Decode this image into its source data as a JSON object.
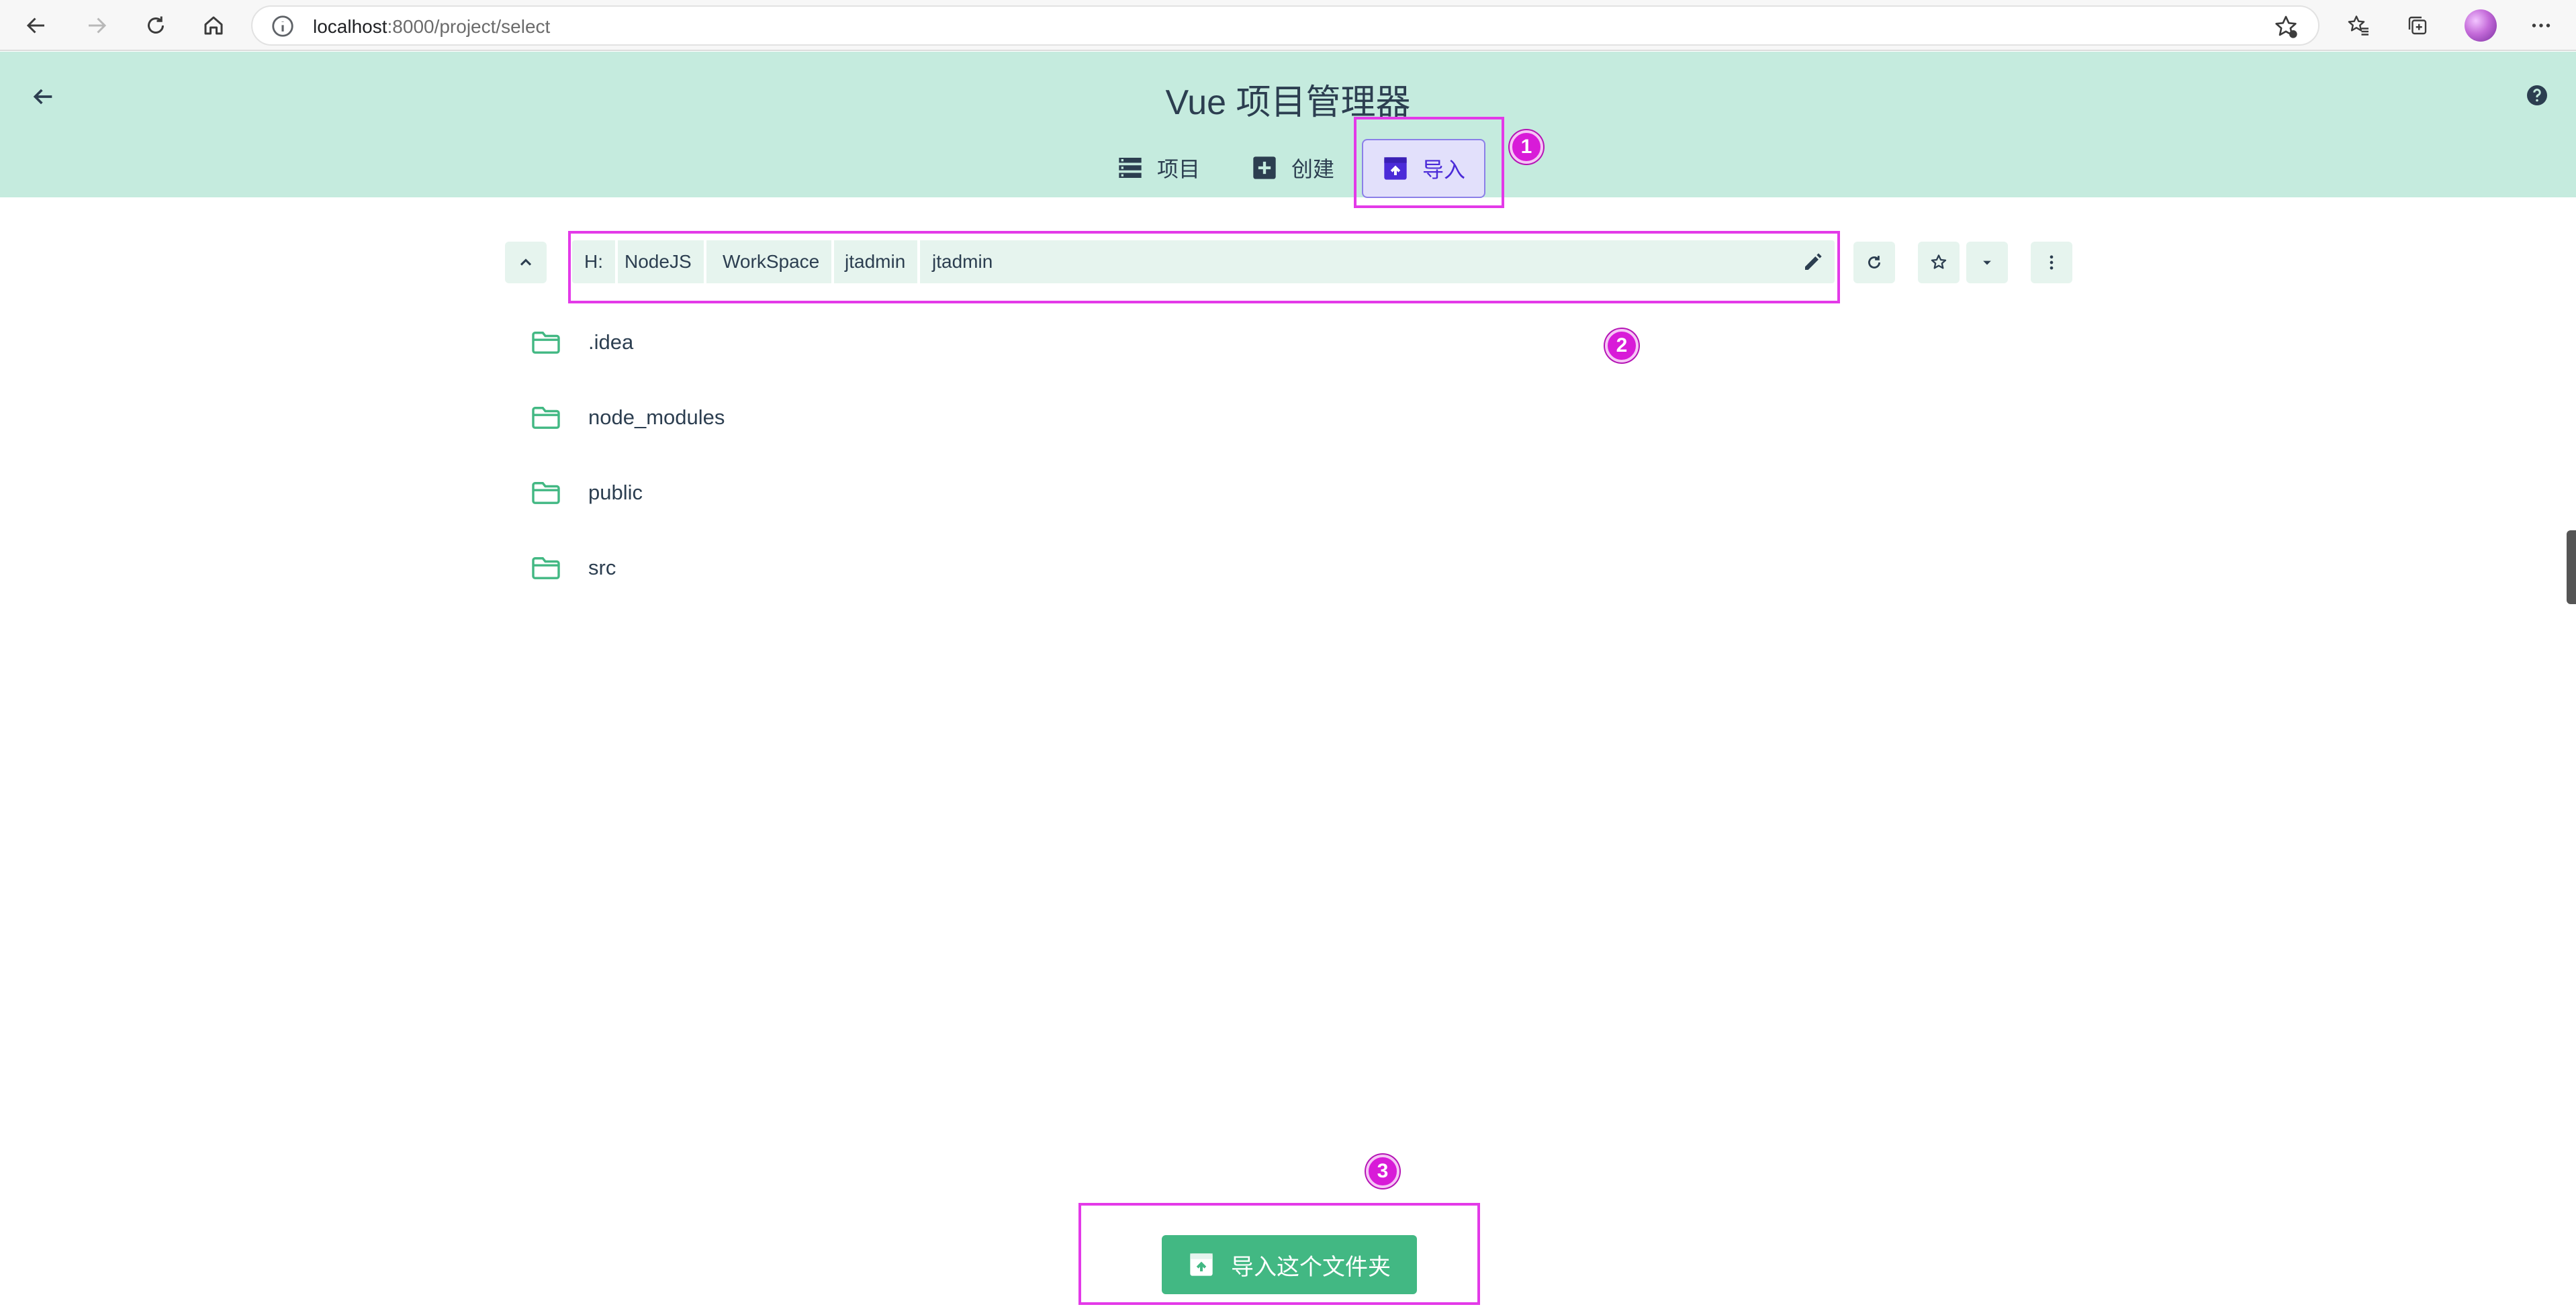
{
  "browser": {
    "url_host": "localhost",
    "url_path": ":8000/project/select"
  },
  "header": {
    "title": "Vue 项目管理器",
    "tabs": [
      {
        "label": "项目",
        "icon": "list-icon",
        "active": false
      },
      {
        "label": "创建",
        "icon": "add-box-icon",
        "active": false
      },
      {
        "label": "导入",
        "icon": "unarchive-icon",
        "active": true
      }
    ]
  },
  "explorer": {
    "path_segments": [
      "H:",
      "NodeJS",
      "WorkSpace",
      "jtadmin",
      "jtadmin"
    ],
    "folders": [
      ".idea",
      "node_modules",
      "public",
      "src"
    ]
  },
  "actions": {
    "import_folder_label": "导入这个文件夹"
  },
  "annotations": [
    "1",
    "2",
    "3"
  ],
  "colors": {
    "header_bg": "#c5ebde",
    "accent_green": "#42b883",
    "active_tab_text": "#4b2bd8",
    "annotation_magenta": "#e33ae8"
  }
}
